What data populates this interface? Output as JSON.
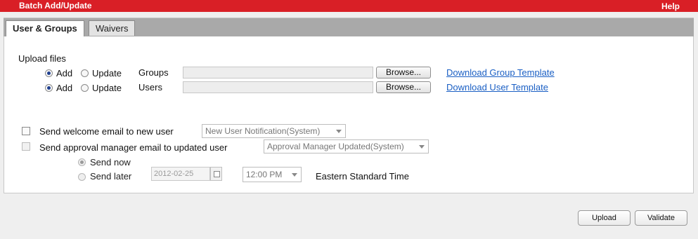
{
  "header": {
    "title": "Batch Add/Update",
    "help_label": "Help"
  },
  "tabs": [
    {
      "label": "User & Groups"
    },
    {
      "label": "Waivers"
    }
  ],
  "upload": {
    "section_label": "Upload files",
    "rows": [
      {
        "add_label": "Add",
        "update_label": "Update",
        "type_label": "Groups",
        "browse_label": "Browse...",
        "template_link": "Download Group Template"
      },
      {
        "add_label": "Add",
        "update_label": "Update",
        "type_label": "Users",
        "browse_label": "Browse...",
        "template_link": "Download User Template"
      }
    ]
  },
  "welcome_email": {
    "label": "Send welcome email to new user",
    "select_value": "New User Notification(System)"
  },
  "approval_email": {
    "label": "Send approval manager email to updated user",
    "select_value": "Approval Manager Updated(System)",
    "send_now_label": "Send now",
    "send_later_label": "Send later",
    "date_value": "2012-02-25",
    "time_value": "12:00 PM",
    "timezone_label": "Eastern Standard Time"
  },
  "footer": {
    "upload_label": "Upload",
    "validate_label": "Validate"
  }
}
